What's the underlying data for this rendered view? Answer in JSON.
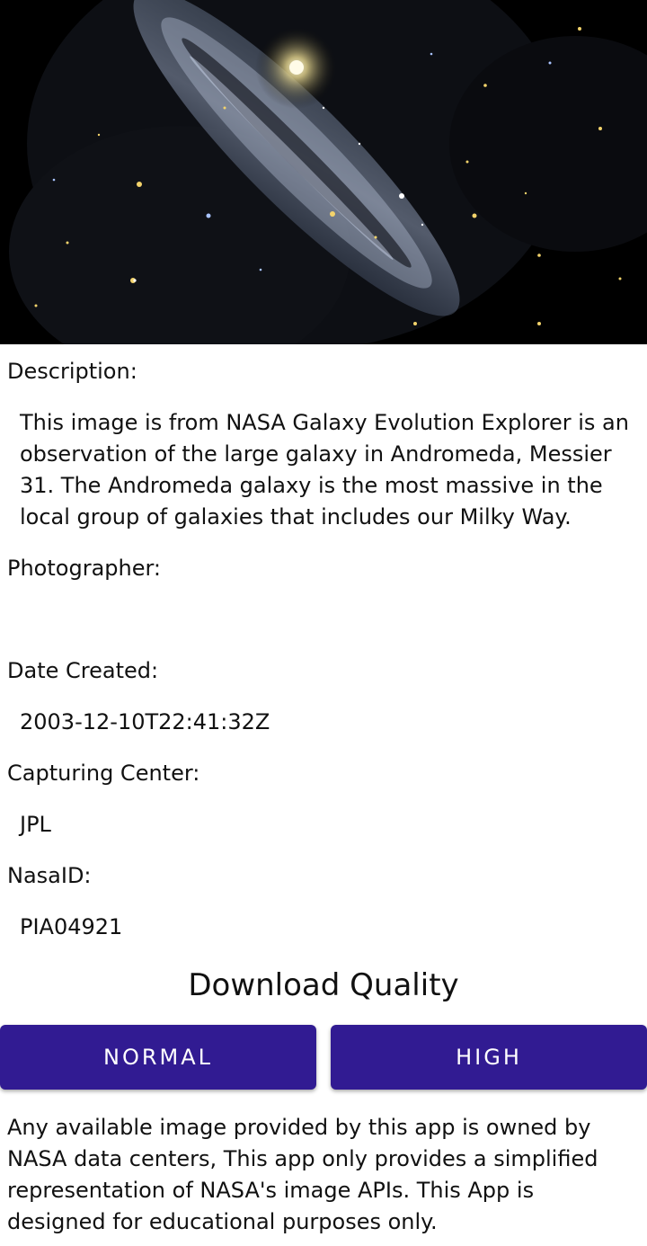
{
  "hero_image": {
    "subject": "andromeda-galaxy-image"
  },
  "details": {
    "description_label": "Description:",
    "description_lines": [
      "This image is from NASA Galaxy Evolution Explorer is an",
      "observation of the large galaxy in Andromeda, Messier",
      "31. The Andromeda galaxy is the most massive in the",
      "local group of galaxies that includes our Milky Way."
    ],
    "photographer_label": "Photographer:",
    "photographer_value": "",
    "date_label": "Date Created:",
    "date_value": "2003-12-10T22:41:32Z",
    "center_label": "Capturing Center:",
    "center_value": "JPL",
    "nasaid_label": "NasaID:",
    "nasaid_value": "PIA04921"
  },
  "download": {
    "title": "Download Quality",
    "normal_label": "NORMAL",
    "high_label": "HIGH",
    "button_color": "#311b92"
  },
  "disclaimer_lines": [
    "Any available image provided by this app is owned by",
    "NASA data centers, This app only provides a simplified",
    "representation of NASA's image APIs. This App is",
    "designed for educational purposes only."
  ]
}
